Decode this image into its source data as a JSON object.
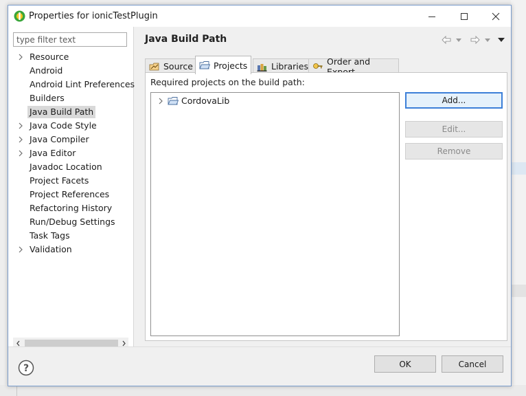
{
  "window": {
    "title": "Properties for ionicTestPlugin",
    "colors": {
      "accent": "#3c7fd8",
      "frame": "#7a9ccc",
      "icon_green": "#3aa63a",
      "icon_yellow": "#f3c623"
    }
  },
  "sidebar": {
    "filter_placeholder": "type filter text",
    "items": [
      {
        "label": "Resource",
        "expandable": true
      },
      {
        "label": "Android",
        "expandable": false
      },
      {
        "label": "Android Lint Preferences",
        "expandable": false
      },
      {
        "label": "Builders",
        "expandable": false
      },
      {
        "label": "Java Build Path",
        "expandable": false,
        "selected": true
      },
      {
        "label": "Java Code Style",
        "expandable": true
      },
      {
        "label": "Java Compiler",
        "expandable": true
      },
      {
        "label": "Java Editor",
        "expandable": true
      },
      {
        "label": "Javadoc Location",
        "expandable": false
      },
      {
        "label": "Project Facets",
        "expandable": false
      },
      {
        "label": "Project References",
        "expandable": false
      },
      {
        "label": "Refactoring History",
        "expandable": false
      },
      {
        "label": "Run/Debug Settings",
        "expandable": false
      },
      {
        "label": "Task Tags",
        "expandable": false
      },
      {
        "label": "Validation",
        "expandable": true
      }
    ]
  },
  "main": {
    "title": "Java Build Path",
    "tabs": [
      {
        "label": "Source",
        "icon": "source-folder-icon"
      },
      {
        "label": "Projects",
        "icon": "project-folder-icon",
        "active": true
      },
      {
        "label": "Libraries",
        "icon": "libraries-icon"
      },
      {
        "label": "Order and Export",
        "icon": "order-export-icon"
      }
    ],
    "list_label": "Required projects on the build path:",
    "projects": [
      {
        "label": "CordovaLib"
      }
    ],
    "buttons": {
      "add": "Add...",
      "edit": "Edit...",
      "remove": "Remove"
    }
  },
  "footer": {
    "ok": "OK",
    "cancel": "Cancel",
    "help_icon": "help-icon"
  }
}
